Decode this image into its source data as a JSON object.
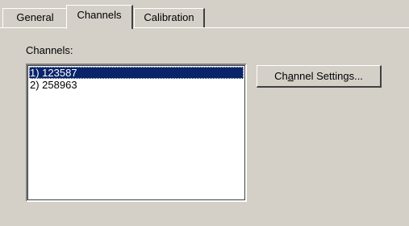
{
  "tabs": [
    {
      "label": "General",
      "active": false
    },
    {
      "label": "Channels",
      "active": true
    },
    {
      "label": "Calibration",
      "active": false
    }
  ],
  "channels_panel": {
    "label": "Channels:",
    "list_items": [
      {
        "text": "1) 123587",
        "selected": true
      },
      {
        "text": "2) 258963",
        "selected": false
      }
    ],
    "channel_settings_button": {
      "label_before": "Ch",
      "label_mnemonic": "a",
      "label_after": "nnel Settings..."
    }
  },
  "colors": {
    "dialog_background": "#d4d0c8",
    "selection_background": "#0a246a",
    "selection_text": "#ffffff"
  }
}
